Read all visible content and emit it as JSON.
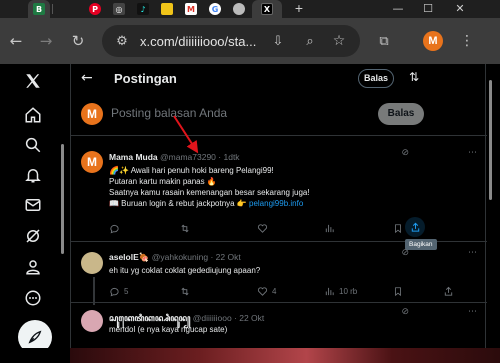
{
  "browser": {
    "tabs": [
      {
        "icon": "bing-icon",
        "label": "B",
        "color": "#1f7a43"
      },
      {
        "icon": "pinterest-icon",
        "label": "P",
        "color": "#e60023"
      },
      {
        "icon": "instagram-icon",
        "label": "◎",
        "color": "#444"
      },
      {
        "icon": "tiktok-icon",
        "label": "♪",
        "color": "#111"
      },
      {
        "icon": "folder-icon",
        "label": "",
        "color": "#f0c419"
      },
      {
        "icon": "gmail-icon",
        "label": "M",
        "color": "#ffffff"
      },
      {
        "icon": "google-icon",
        "label": "G",
        "color": "#ffffff"
      },
      {
        "icon": "bookmark-icon",
        "label": "",
        "color": "#bbbbbb"
      },
      {
        "icon": "x-icon",
        "label": "X",
        "color": "#000000"
      }
    ],
    "new_tab": "+",
    "window_controls": {
      "minimize": "—",
      "maximize": "☐",
      "close": "✕"
    },
    "address": "x.com/diiiiiiooo/sta...",
    "profile_initial": "M"
  },
  "nav": {
    "items": [
      "x-logo-icon",
      "home-icon",
      "search-icon",
      "notifications-icon",
      "messages-icon",
      "grok-icon",
      "profile-icon",
      "more-icon"
    ],
    "post_button": "compose-icon"
  },
  "header": {
    "title": "Postingan",
    "reply_pill": "Balas"
  },
  "compose": {
    "avatar": "M",
    "placeholder": "Posting balasan Anda",
    "button": "Balas"
  },
  "tweets": [
    {
      "avatar": "M",
      "name": "Mama Muda",
      "handle": "@mama73290",
      "time": "· 1dtk",
      "lines": [
        "🌈✨ Awali hari penuh hoki bareng Pelangi99!",
        "Putaran kartu makin panas 🔥",
        "Saatnya kamu rasain kemenangan besar sekarang juga!",
        "📖 Buruan login & rebut jackpotnya 👉 "
      ],
      "link": "pelangi99b.info",
      "tooltip": "Bagikan"
    },
    {
      "name": "aselolE🍖",
      "handle": "@yahkokuning",
      "time": "· 22 Okt",
      "lines": [
        "eh itu yg coklat coklat gedediujung apaan?"
      ],
      "counts": {
        "replies": "5",
        "retweets": "",
        "likes": "4",
        "views": "10 rb"
      }
    },
    {
      "name": "ꦱꦸꦏꦺꦠꦶꦏꦤ꧀ꦱꦶꦤꦸꦤ꧀",
      "handle": "@diiiiiiooo",
      "time": "· 22 Okt",
      "lines": [
        "méndol (e nya kaya ngucap sate)"
      ]
    }
  ],
  "colors": {
    "background": "#000000",
    "accent": "#1d9bf0",
    "text": "#e7e9ea",
    "muted": "#71767b",
    "avatar_orange": "#e8731c",
    "arrow_red": "#e0141b"
  }
}
